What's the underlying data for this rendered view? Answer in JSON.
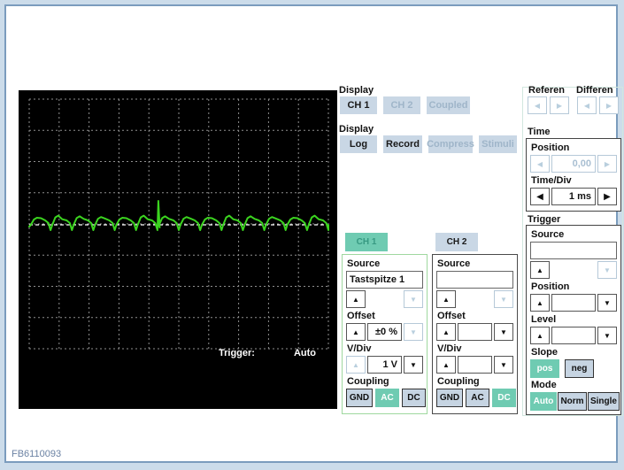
{
  "colors": {
    "accent_teal": "#6fcbb2",
    "frame_border": "#7b9cbd",
    "waveform_green": "#3bd41f",
    "screen_bg": "#000000"
  },
  "icons": {
    "up": "▲",
    "down": "▼",
    "left": "◀",
    "right": "▶"
  },
  "footer": {
    "code": "FB6110093"
  },
  "scope": {
    "trigger_label": "Trigger:",
    "trigger_mode": "Auto"
  },
  "display_channels": {
    "label": "Display",
    "ch1": "CH 1",
    "ch2": "CH 2",
    "coupled": "Coupled"
  },
  "display_modes": {
    "label": "Display",
    "log": "Log",
    "record": "Record",
    "compress": "Compress",
    "stimuli": "Stimuli"
  },
  "reference": {
    "label": "Referen"
  },
  "difference": {
    "label": "Differen"
  },
  "time": {
    "label": "Time",
    "position_label": "Position",
    "position_value": "0,00",
    "timediv_label": "Time/Div",
    "timediv_value": "1 ms"
  },
  "trigger": {
    "label": "Trigger",
    "source_label": "Source",
    "source_value": "",
    "position_label": "Position",
    "position_value": "",
    "level_label": "Level",
    "level_value": "",
    "slope_label": "Slope",
    "slope_pos": "pos",
    "slope_neg": "neg",
    "mode_label": "Mode",
    "mode_auto": "Auto",
    "mode_norm": "Norm",
    "mode_single": "Single"
  },
  "ch1": {
    "tab": "CH 1",
    "source_label": "Source",
    "source_value": "Tastspitze 1",
    "offset_label": "Offset",
    "offset_value": "±0 %",
    "vdiv_label": "V/Div",
    "vdiv_value": "1 V",
    "coupling_label": "Coupling",
    "gnd": "GND",
    "ac": "AC",
    "dc": "DC"
  },
  "ch2": {
    "tab": "CH 2",
    "source_label": "Source",
    "source_value": "",
    "offset_label": "Offset",
    "offset_value": "",
    "vdiv_label": "V/Div",
    "vdiv_value": "",
    "coupling_label": "Coupling",
    "gnd": "GND",
    "ac": "AC",
    "dc": "DC"
  }
}
